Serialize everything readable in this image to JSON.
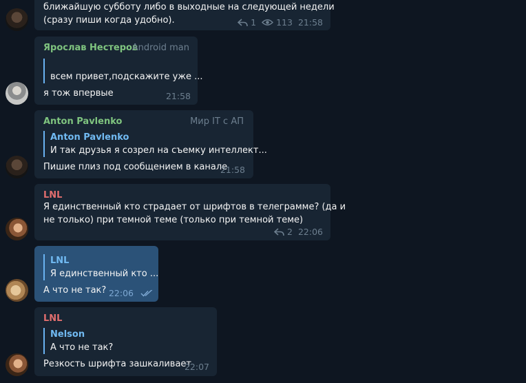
{
  "colors": {
    "background": "#0e1621",
    "bubble_in": "#182533",
    "bubble_out": "#2b5278",
    "sender_green": "#7fc47f",
    "sender_red": "#e16e6e",
    "quote_accent": "#6ab3f3",
    "meta_text": "#6d7f8f"
  },
  "messages": [
    {
      "lines": [
        "ближайшую субботу либо в выходные на следующей недели",
        "(сразу пиши когда удобно)."
      ],
      "replies_count": "1",
      "views": "113",
      "time": "21:58"
    },
    {
      "sender": "Ярослав Нестеров",
      "badge": "Android man",
      "quote_text": "всем привет,подскажите уже ...",
      "text": "я тож впервые",
      "time": "21:58"
    },
    {
      "sender": "Anton Pavlenko",
      "badge": "Мир IT с АП",
      "quote_name": "Anton Pavlenko",
      "quote_text": "И так друзья я созрел на съемку интеллект...",
      "text": "Пишие плиз под сообщением в канале",
      "time": "21:58"
    },
    {
      "sender": "LNL",
      "lines": [
        "Я единственный кто страдает от шрифтов в телеграмме? (да и",
        "не только) при темной теме (только при темной теме)"
      ],
      "replies_count": "2",
      "time": "22:06"
    },
    {
      "quote_name": "LNL",
      "quote_text": "Я единственный кто ...",
      "text": "А что не так?",
      "time": "22:06",
      "status": "read"
    },
    {
      "sender": "LNL",
      "quote_name": "Nelson",
      "quote_text": "А что не так?",
      "text": "Резкость шрифта зашкаливает",
      "time": "22:07"
    }
  ]
}
